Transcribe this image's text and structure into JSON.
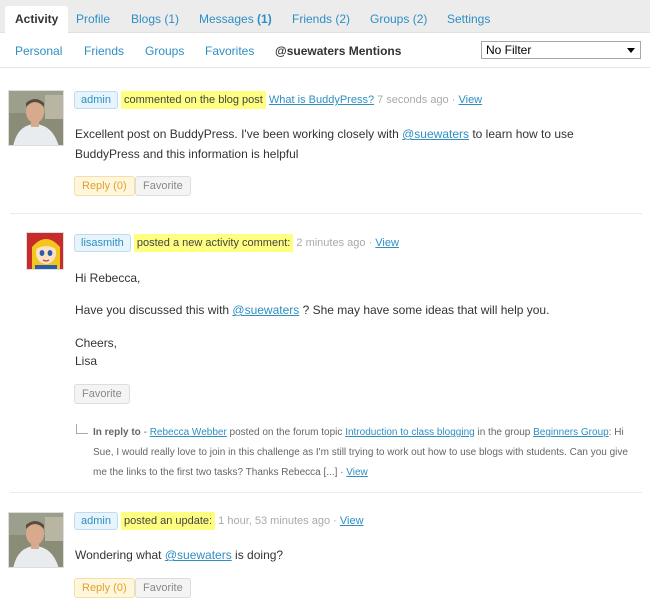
{
  "main_tabs": [
    {
      "label": "Activity"
    },
    {
      "label": "Profile"
    },
    {
      "label": "Blogs",
      "count": "(1)"
    },
    {
      "label": "Messages",
      "count": "(1)"
    },
    {
      "label": "Friends",
      "count": "(2)"
    },
    {
      "label": "Groups",
      "count": "(2)"
    },
    {
      "label": "Settings"
    }
  ],
  "sub_nav": {
    "items": [
      "Personal",
      "Friends",
      "Groups",
      "Favorites"
    ],
    "current": "@suewaters Mentions"
  },
  "filter": {
    "selected": "No Filter"
  },
  "activities": [
    {
      "user": "admin",
      "action": "commented on the blog post",
      "target": "What is BuddyPress?",
      "time": "7 seconds ago",
      "separator": "·",
      "view": "View",
      "text_before": "Excellent post on BuddyPress. I've been working closely with ",
      "mention": "@suewaters",
      "text_after": " to learn how to use BuddyPress and this information is helpful",
      "reply": "Reply (0)",
      "favorite": "Favorite"
    },
    {
      "user": "lisasmith",
      "action": "posted a new activity comment:",
      "time": "2 minutes ago",
      "separator": "·",
      "view": "View",
      "line1": "Hi Rebecca,",
      "line2_before": "Have you discussed this with ",
      "mention": "@suewaters",
      "line2_after": " ? She may have some ideas that will help you.",
      "line3": "Cheers,",
      "line4": "Lisa",
      "favorite": "Favorite",
      "in_reply": {
        "label": "In reply to",
        "dash": " - ",
        "author": "Rebecca Webber",
        "text1": " posted on the forum topic ",
        "topic": "Introduction to class blogging",
        "text2": " in the group ",
        "group": "Beginners Group",
        "text3": ": Hi Sue, I would really love to join in this challenge as I'm still trying to work out how to use blogs with students. Can you give me the links to the first two tasks? Thanks Rebecca [...] ",
        "separator": "·",
        "view": "View"
      }
    },
    {
      "user": "admin",
      "action": "posted an update:",
      "time": "1 hour, 53 minutes ago",
      "separator": "·",
      "view": "View",
      "text_before": "Wondering what ",
      "mention": "@suewaters",
      "text_after": " is doing?",
      "reply": "Reply (0)",
      "favorite": "Favorite"
    }
  ]
}
